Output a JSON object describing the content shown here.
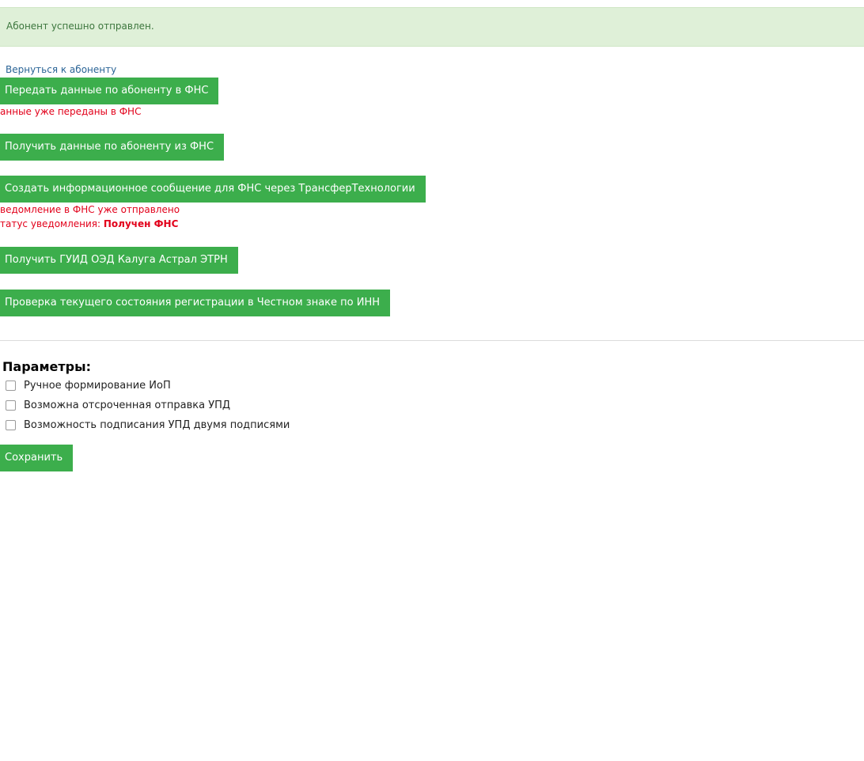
{
  "alert": {
    "text": "Абонент успешно отправлен."
  },
  "back_link": "Вернуться к абоненту",
  "actions": {
    "send_fns": "Передать данные по абоненту в ФНС",
    "send_fns_error": "анные уже переданы в ФНС",
    "get_fns": "Получить данные по абоненту из ФНС",
    "create_message": "Создать информационное сообщение для ФНС через ТрансферТехнологии",
    "notice_sent": "ведомление в ФНС уже отправлено",
    "notice_status_label": "татус уведомления:",
    "notice_status_value": "Получен ФНС",
    "get_guid": "Получить ГУИД ОЭД Калуга Астрал ЭТРН",
    "check_registration": "Проверка текущего состояния регистрации в Честном знаке по ИНН"
  },
  "params": {
    "title": "Параметры:",
    "options": [
      {
        "label": "Ручное формирование ИоП",
        "checked": false
      },
      {
        "label": "Возможна отсроченная отправка УПД",
        "checked": false
      },
      {
        "label": "Возможность подписания УПД двумя подписями",
        "checked": false
      }
    ],
    "save_label": "Сохранить"
  },
  "colors": {
    "button_green": "#3cae4c",
    "alert_bg": "#dff0d8",
    "alert_text": "#3c763d",
    "error_red": "#e2001a",
    "link_blue": "#2a6496"
  }
}
